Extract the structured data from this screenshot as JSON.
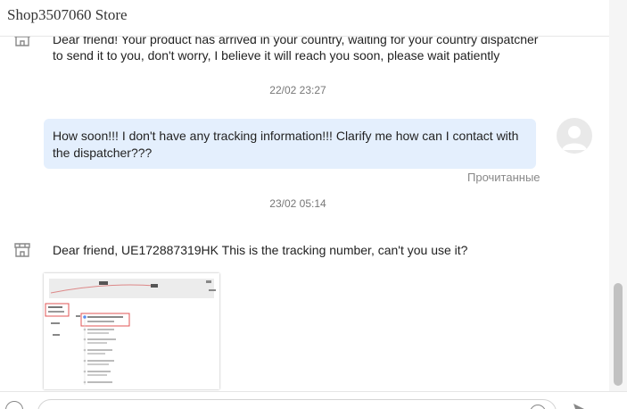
{
  "header": {
    "title": "Shop3507060 Store"
  },
  "messages": {
    "seller_1": {
      "line1": "Dear friend! Your product has arrived in your country, waiting for your country dispatcher",
      "line2": "to send it to you, don't worry, I believe it will reach you soon, please wait patiently"
    },
    "timestamp_1": "22/02 23:27",
    "buyer_1": {
      "text": "How soon!!! I don't have any tracking information!!! Clarify me how can I contact with the dispatcher???",
      "status": "Прочитанные"
    },
    "timestamp_2": "23/02 05:14",
    "seller_2": {
      "text": "Dear friend, UE172887319HK This is the tracking number, can't you use it?"
    }
  },
  "input": {
    "placeholder": ""
  },
  "colors": {
    "buyer_bubble": "#e4effd",
    "highlight_box": "#e05555"
  },
  "icons": {
    "seller_avatar": "store-icon",
    "buyer_avatar": "user-avatar-icon",
    "emoji": "emoji-icon",
    "attach": "attach-icon",
    "send": "send-icon"
  }
}
